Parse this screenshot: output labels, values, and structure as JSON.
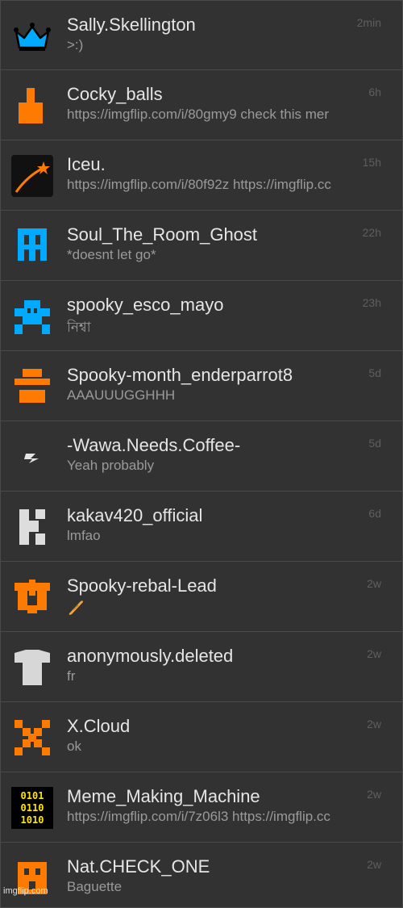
{
  "conversations": [
    {
      "name": "Sally.Skellington",
      "preview": ">:)",
      "time": "2min",
      "icon": "crown-icon"
    },
    {
      "name": "Cocky_balls",
      "preview": "https://imgflip.com/i/80gmy9 check this mer",
      "time": "6h",
      "icon": "orange-block-icon"
    },
    {
      "name": "Iceu.",
      "preview": "https://imgflip.com/i/80f92z https://imgflip.cc",
      "time": "15h",
      "icon": "shooting-star-icon"
    },
    {
      "name": "Soul_The_Room_Ghost",
      "preview": "*doesnt let go*",
      "time": "22h",
      "icon": "blue-pixel-ghost-icon"
    },
    {
      "name": "spooky_esco_mayo",
      "preview": "নিশ্বা",
      "time": "23h",
      "icon": "blue-pixel-invader-icon"
    },
    {
      "name": "Spooky-month_enderparrot8",
      "preview": "AAAUUUGGHHH",
      "time": "5d",
      "icon": "orange-hat-icon"
    },
    {
      "name": "-Wawa.Needs.Coffee-",
      "preview": "Yeah probably",
      "time": "5d",
      "icon": "lightning-icon"
    },
    {
      "name": "kakav420_official",
      "preview": "lmfao",
      "time": "6d",
      "icon": "pixel-k-icon"
    },
    {
      "name": "Spooky-rebal-Lead",
      "preview": "",
      "time": "2w",
      "icon": "orange-pixel-u-icon"
    },
    {
      "name": "anonymously.deleted",
      "preview": "fr",
      "time": "2w",
      "icon": "tshirt-icon"
    },
    {
      "name": "X.Cloud",
      "preview": "ok",
      "time": "2w",
      "icon": "orange-pixel-x-icon"
    },
    {
      "name": "Meme_Making_Machine",
      "preview": "https://imgflip.com/i/7z06l3 https://imgflip.cc",
      "time": "2w",
      "icon": "binary-code-icon"
    },
    {
      "name": "Nat.CHECK_ONE",
      "preview": "Baguette",
      "time": "2w",
      "icon": "orange-pixel-face-icon"
    }
  ],
  "watermark": "imgflip.com",
  "colors": {
    "background": "#2b2b2b",
    "row": "#323232",
    "name": "#e6e6e6",
    "preview": "#9a9a9a",
    "time": "#5f5f5f",
    "orange": "#ff7a00",
    "blue": "#00aaff"
  }
}
